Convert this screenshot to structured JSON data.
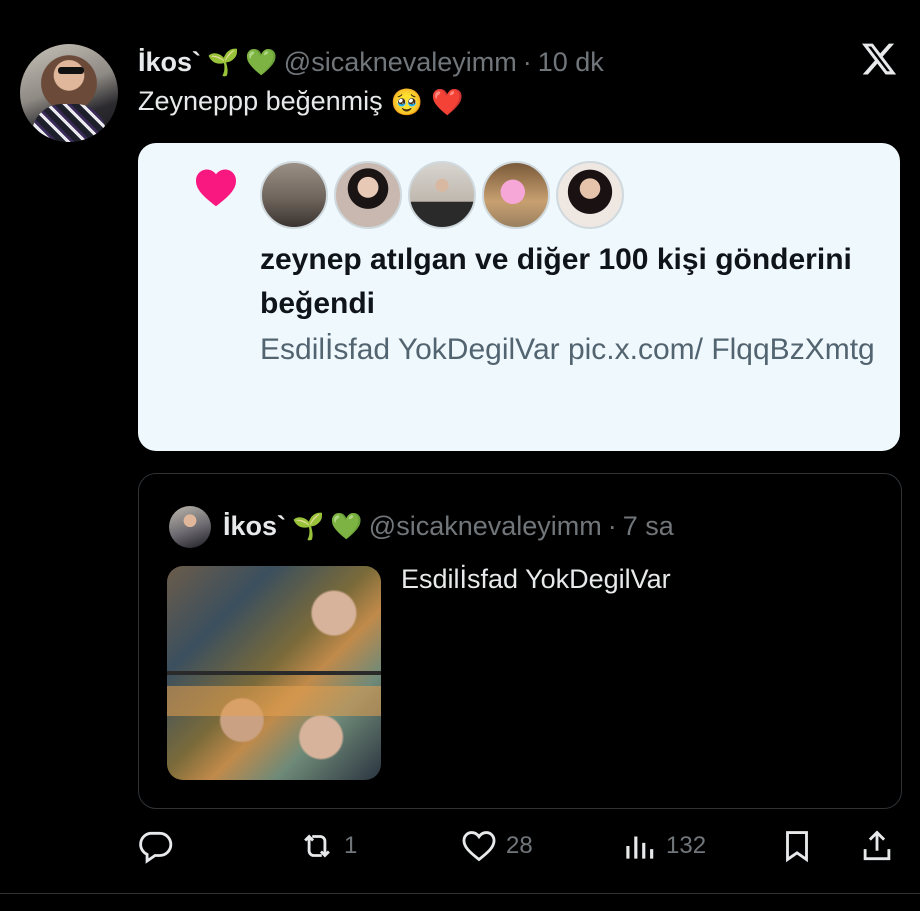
{
  "tweet": {
    "author_name": "İkos`",
    "author_emojis": [
      "🌱",
      "💚"
    ],
    "handle": "@sicaknevaleyimm",
    "separator": "·",
    "time": "10 dk",
    "text": "Zeyneppp beğenmiş",
    "text_emojis": [
      "🥹",
      "❤️"
    ],
    "platform_icon": "x-logo-icon"
  },
  "like_card": {
    "icon": "heart-icon",
    "icon_color": "#f91880",
    "liker_avatars": 5,
    "line1": "zeynep atılgan ve diğer 100 kişi gönderini beğendi",
    "line2": "Esdilİsfad YokDegilVar pic.x.com/ FlqqBzXmtg"
  },
  "quoted": {
    "author_name": "İkos`",
    "author_emojis": [
      "🌱",
      "💚"
    ],
    "handle": "@sicaknevaleyimm",
    "separator": "·",
    "time": "7 sa",
    "text": "Esdilİsfad YokDegilVar",
    "media": "painting-of-couple-image"
  },
  "actions": {
    "reply": {
      "icon": "reply-icon",
      "count": ""
    },
    "repost": {
      "icon": "repost-icon",
      "count": "1"
    },
    "like": {
      "icon": "heart-outline-icon",
      "count": "28"
    },
    "views": {
      "icon": "views-icon",
      "count": "132"
    },
    "bookmark": {
      "icon": "bookmark-icon"
    },
    "share": {
      "icon": "share-icon"
    }
  },
  "colors": {
    "background": "#000000",
    "primary_text": "#e7e9ea",
    "secondary_text": "#71767b",
    "card_background": "#eff8fd",
    "border": "#2f3336"
  }
}
